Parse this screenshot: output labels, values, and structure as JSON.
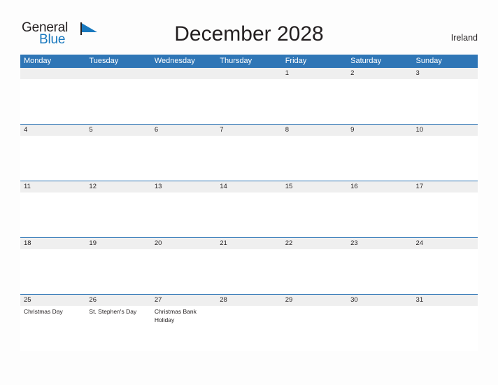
{
  "brand": {
    "line1": "General",
    "line2": "Blue",
    "flag_color": "#1878be"
  },
  "header": {
    "title": "December 2028",
    "country": "Ireland"
  },
  "colors": {
    "header_blue": "#2f76b6",
    "date_band_gray": "#efefef",
    "text": "#231f20",
    "page_background": "#fdfdfd"
  },
  "calendar": {
    "month": "December",
    "year": "2028",
    "weekdays": [
      "Monday",
      "Tuesday",
      "Wednesday",
      "Thursday",
      "Friday",
      "Saturday",
      "Sunday"
    ],
    "weeks": [
      {
        "days": [
          {
            "date": "",
            "event": ""
          },
          {
            "date": "",
            "event": ""
          },
          {
            "date": "",
            "event": ""
          },
          {
            "date": "",
            "event": ""
          },
          {
            "date": "1",
            "event": ""
          },
          {
            "date": "2",
            "event": ""
          },
          {
            "date": "3",
            "event": ""
          }
        ]
      },
      {
        "days": [
          {
            "date": "4",
            "event": ""
          },
          {
            "date": "5",
            "event": ""
          },
          {
            "date": "6",
            "event": ""
          },
          {
            "date": "7",
            "event": ""
          },
          {
            "date": "8",
            "event": ""
          },
          {
            "date": "9",
            "event": ""
          },
          {
            "date": "10",
            "event": ""
          }
        ]
      },
      {
        "days": [
          {
            "date": "11",
            "event": ""
          },
          {
            "date": "12",
            "event": ""
          },
          {
            "date": "13",
            "event": ""
          },
          {
            "date": "14",
            "event": ""
          },
          {
            "date": "15",
            "event": ""
          },
          {
            "date": "16",
            "event": ""
          },
          {
            "date": "17",
            "event": ""
          }
        ]
      },
      {
        "days": [
          {
            "date": "18",
            "event": ""
          },
          {
            "date": "19",
            "event": ""
          },
          {
            "date": "20",
            "event": ""
          },
          {
            "date": "21",
            "event": ""
          },
          {
            "date": "22",
            "event": ""
          },
          {
            "date": "23",
            "event": ""
          },
          {
            "date": "24",
            "event": ""
          }
        ]
      },
      {
        "days": [
          {
            "date": "25",
            "event": "Christmas Day"
          },
          {
            "date": "26",
            "event": "St. Stephen's Day"
          },
          {
            "date": "27",
            "event": "Christmas Bank Holiday"
          },
          {
            "date": "28",
            "event": ""
          },
          {
            "date": "29",
            "event": ""
          },
          {
            "date": "30",
            "event": ""
          },
          {
            "date": "31",
            "event": ""
          }
        ]
      }
    ]
  }
}
